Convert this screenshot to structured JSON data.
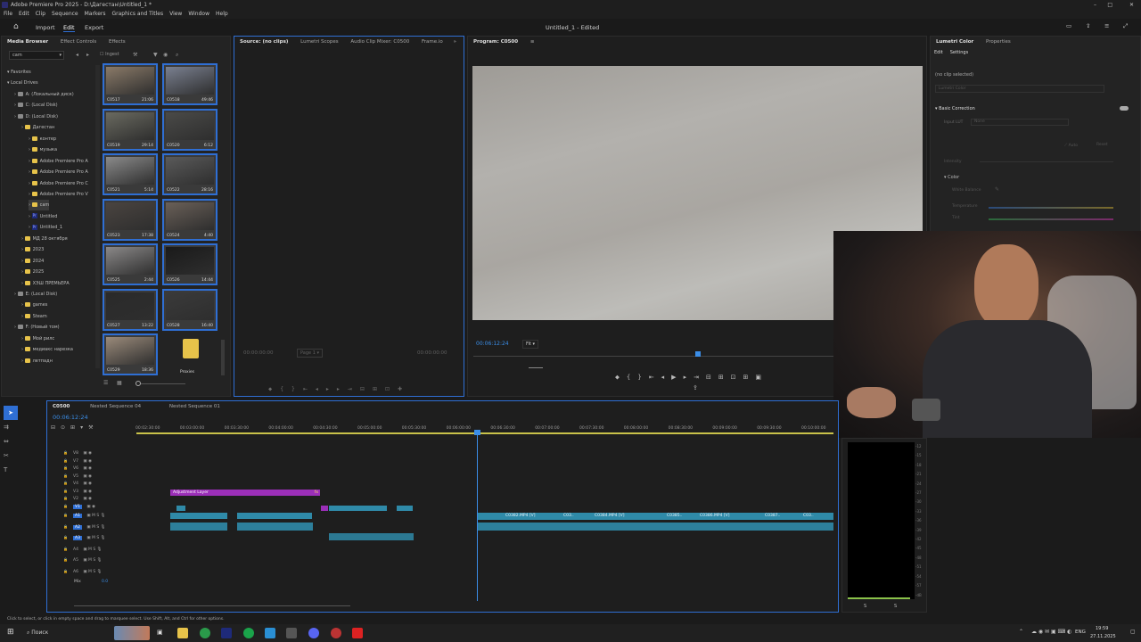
{
  "window": {
    "title": "Adobe Premiere Pro 2025 - D:\\Дагестан\\Untitled_1 *"
  },
  "menu": [
    "File",
    "Edit",
    "Clip",
    "Sequence",
    "Markers",
    "Graphics and Titles",
    "View",
    "Window",
    "Help"
  ],
  "workspace": {
    "tabs": [
      "Import",
      "Edit",
      "Export"
    ],
    "active": "Edit",
    "doc_title": "Untitled_1 - Edited"
  },
  "media_browser": {
    "tabs": [
      "Media Browser",
      "Effect Controls",
      "Effects"
    ],
    "location": "cam",
    "ingest_label": "Ingest",
    "tree": [
      {
        "label": "Favorites",
        "type": "header"
      },
      {
        "label": "Local Drives",
        "type": "header"
      },
      {
        "label": "A: (Локальный диск)",
        "type": "drive"
      },
      {
        "label": "C: (Local Disk)",
        "type": "drive"
      },
      {
        "label": "D: (Local Disk)",
        "type": "drive"
      },
      {
        "label": "Дагестан",
        "type": "folder"
      },
      {
        "label": "контер",
        "type": "folder"
      },
      {
        "label": "музыка",
        "type": "folder"
      },
      {
        "label": "Adobe Premiere Pro A",
        "type": "folder"
      },
      {
        "label": "Adobe Premiere Pro A",
        "type": "folder"
      },
      {
        "label": "Adobe Premiere Pro C",
        "type": "folder"
      },
      {
        "label": "Adobe Premiere Pro V",
        "type": "folder"
      },
      {
        "label": "cam",
        "type": "folder"
      },
      {
        "label": "Untitled",
        "type": "pr"
      },
      {
        "label": "Untitled_1",
        "type": "pr"
      },
      {
        "label": "МД 28 октября",
        "type": "folder"
      },
      {
        "label": "2023",
        "type": "folder"
      },
      {
        "label": "2024",
        "type": "folder"
      },
      {
        "label": "2025",
        "type": "folder"
      },
      {
        "label": "ХЭШ ПРЕМЬЕРА",
        "type": "folder"
      },
      {
        "label": "E: (Local Disk)",
        "type": "drive"
      },
      {
        "label": "games",
        "type": "folder"
      },
      {
        "label": "Steam",
        "type": "folder"
      },
      {
        "label": "F: (Новый том)",
        "type": "drive"
      },
      {
        "label": "Мой рилс",
        "type": "folder"
      },
      {
        "label": "медиакс нарезка",
        "type": "folder"
      },
      {
        "label": "летпадн",
        "type": "folder"
      }
    ],
    "clips": [
      {
        "name": "C0517",
        "dur": "21:06"
      },
      {
        "name": "C0518",
        "dur": "49:46"
      },
      {
        "name": "C0519",
        "dur": "29:14"
      },
      {
        "name": "C0520",
        "dur": "6:12"
      },
      {
        "name": "C0521",
        "dur": "5:14"
      },
      {
        "name": "C0522",
        "dur": "28:16"
      },
      {
        "name": "C0523",
        "dur": "17:38"
      },
      {
        "name": "C0524",
        "dur": "4:40"
      },
      {
        "name": "C0525",
        "dur": "2:44"
      },
      {
        "name": "C0526",
        "dur": "14:44"
      },
      {
        "name": "C0527",
        "dur": "13:22"
      },
      {
        "name": "C0528",
        "dur": "16:40"
      },
      {
        "name": "C0529",
        "dur": "18:36"
      },
      {
        "name": "Proxies",
        "dur": ""
      }
    ]
  },
  "source_panel": {
    "tabs": [
      "Source: (no clips)",
      "Lumetri Scopes",
      "Audio Clip Mixer: C0500",
      "Frame.io"
    ],
    "tc_left": "00:00:00:00",
    "tc_right": "00:00:00:00",
    "page": "Page 1"
  },
  "program_panel": {
    "title": "Program: C0500",
    "timecode": "00:06:12:24",
    "fit": "Fit"
  },
  "lumetri": {
    "tabs": [
      "Lumetri Color",
      "Properties"
    ],
    "subtabs": [
      "Edit",
      "Settings"
    ],
    "no_clip": "(no clip selected)",
    "preset": "Lumetri Color",
    "section_basic": "Basic Correction",
    "input_lut_label": "Input LUT",
    "input_lut_value": "None",
    "auto": "Auto",
    "reset": "Reset",
    "intensity": "Intensity",
    "color_section": "Color",
    "white_balance": "White Balance",
    "temperature": "Temperature",
    "tint": "Tint"
  },
  "timeline": {
    "tabs": [
      "C0500",
      "Nested Sequence 04",
      "Nested Sequence 01"
    ],
    "timecode": "00:06:12:24",
    "ruler": [
      "00:02:30:00",
      "00:03:00:00",
      "00:03:30:00",
      "00:04:00:00",
      "00:04:30:00",
      "00:05:00:00",
      "00:05:30:00",
      "00:06:00:00",
      "00:06:30:00",
      "00:07:00:00",
      "00:07:30:00",
      "00:08:00:00",
      "00:08:30:00",
      "00:09:00:00",
      "00:09:30:00",
      "00:10:00:00"
    ],
    "video_tracks": [
      "V8",
      "V7",
      "V6",
      "V5",
      "V4",
      "V3",
      "V2",
      "V1"
    ],
    "audio_tracks": [
      "A1",
      "A2",
      "A3",
      "A4",
      "A5",
      "A6"
    ],
    "mix_label": "Mix",
    "mix_value": "0.0",
    "adjustment_layer": "Adjustment Layer",
    "clip_labels": [
      "C0382.MP4 [V]",
      "C03..",
      "C0384.MP4 [V]",
      "C0385..",
      "C0386.MP4 [V]",
      "C0387..",
      "C03.."
    ]
  },
  "meter": {
    "scale": [
      "-12",
      "-15",
      "-18",
      "-21",
      "-24",
      "-27",
      "-30",
      "-33",
      "-36",
      "-39",
      "-42",
      "-45",
      "-48",
      "-51",
      "-54",
      "-57",
      "-dB"
    ],
    "labels": [
      "S",
      "S"
    ]
  },
  "status_bar": "Click to select, or click in empty space and drag to marquee select. Use Shift, Alt, and Ctrl for other options.",
  "taskbar": {
    "search": "Поиск",
    "lang": "ENG",
    "time": "19:59",
    "date": "27.11.2025"
  },
  "colors": {
    "accent": "#2f6fd4",
    "adjustment": "#9b2fb8",
    "clip": "#2f8aa8",
    "playhead": "#3b8ee8"
  }
}
